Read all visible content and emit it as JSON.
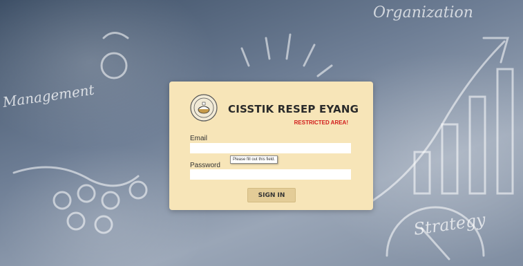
{
  "background": {
    "handwritten_words": [
      "Organization",
      "Management",
      "Strategy"
    ]
  },
  "login": {
    "brand": "CISSTIK RESEP EYANG",
    "restricted": "RESTRICTED AREA!",
    "email_label": "Email",
    "email_value": "",
    "password_label": "Password",
    "password_value": "",
    "validation_tooltip": "Please fill out this field.",
    "signin_label": "SIGN IN",
    "logo_icon": "chef-pot-logo-icon"
  },
  "colors": {
    "card": "#f7e5b8",
    "button": "#e3cc97",
    "restricted": "#d11a1a"
  }
}
